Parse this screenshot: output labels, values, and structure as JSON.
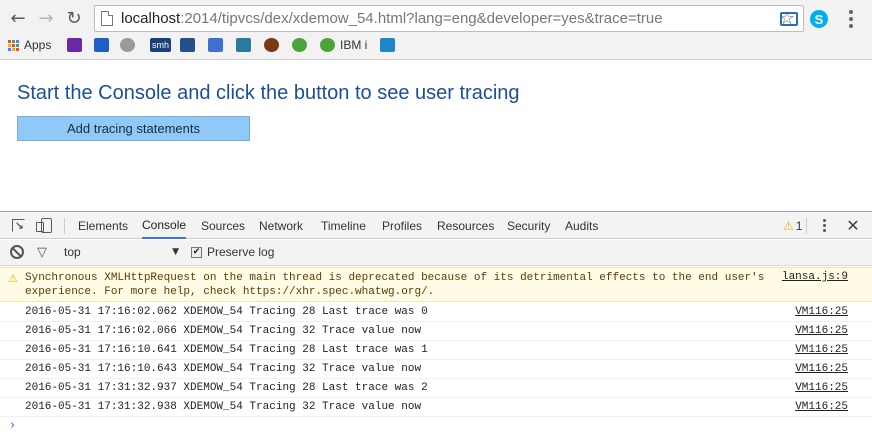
{
  "browser": {
    "nav": {
      "back": "←",
      "forward": "→",
      "reload": "↻"
    },
    "url_host": "localhost",
    "url_path": ":2014/tipvcs/dex/xdemow_54.html?lang=eng&developer=yes&trace=true",
    "star": "☆",
    "skype": "S",
    "bookmarks": [
      {
        "label": "Apps",
        "icon": "apps-grid-icon"
      },
      {
        "label": "",
        "icon": "yahoo-mail-icon",
        "color": "#6a2aa8"
      },
      {
        "label": "",
        "icon": "mail-icon",
        "color": "#1c5fc7"
      },
      {
        "label": "",
        "icon": "disc-icon",
        "color": "#9a9a9a"
      },
      {
        "label": "",
        "text": "smh",
        "icon": "smh-icon",
        "color": "#1a3f7a"
      },
      {
        "label": "",
        "icon": "cloud-people-icon",
        "color": "#234f8a"
      },
      {
        "label": "",
        "icon": "html5-icon",
        "color": "#3f6fd0"
      },
      {
        "label": "",
        "icon": "w3-icon",
        "color": "#2a7a9f"
      },
      {
        "label": "",
        "icon": "football-icon",
        "color": "#7a3b12"
      },
      {
        "label": "",
        "icon": "gear-bookmark-icon",
        "color": "#4aa43a"
      },
      {
        "label": "IBM i",
        "icon": "ibmi-gear-icon",
        "color": "#4aa43a"
      },
      {
        "label": "",
        "icon": "app-tile-icon",
        "color": "#1d86c9"
      }
    ]
  },
  "page": {
    "heading": "Start the Console and click the button to see user tracing",
    "button_label": "Add tracing statements",
    "colors": {
      "heading": "#1c4f9a",
      "button_bg": "#8ec9f8"
    }
  },
  "devtools": {
    "tabs": [
      "Elements",
      "Console",
      "Sources",
      "Network",
      "Timeline",
      "Profiles",
      "Resources",
      "Security",
      "Audits"
    ],
    "active_tab": "Console",
    "warning_count": "1",
    "close": "✕",
    "filter": {
      "context": "top",
      "preserve_log_label": "Preserve log",
      "preserve_log_checked": true,
      "check_mark": "✔"
    },
    "warning": {
      "icon": "⚠",
      "text": "Synchronous XMLHttpRequest on the main thread is deprecated because of its detrimental effects to the end user's experience. For more help, check https://xhr.spec.whatwg.org/.",
      "source": "lansa.js:9"
    },
    "logs": [
      {
        "text": "2016-05-31 17:16:02.062 XDEMOW_54 Tracing 28 Last trace was 0",
        "source": "VM116:25"
      },
      {
        "text": "2016-05-31 17:16:02.066 XDEMOW_54 Tracing 32 Trace value now",
        "source": "VM116:25"
      },
      {
        "text": "2016-05-31 17:16:10.641 XDEMOW_54 Tracing 28 Last trace was 1",
        "source": "VM116:25"
      },
      {
        "text": "2016-05-31 17:16:10.643 XDEMOW_54 Tracing 32 Trace value now",
        "source": "VM116:25"
      },
      {
        "text": "2016-05-31 17:31:32.937 XDEMOW_54 Tracing 28 Last trace was 2",
        "source": "VM116:25"
      },
      {
        "text": "2016-05-31 17:31:32.938 XDEMOW_54 Tracing 32 Trace value now",
        "source": "VM116:25"
      }
    ],
    "prompt": "›"
  }
}
